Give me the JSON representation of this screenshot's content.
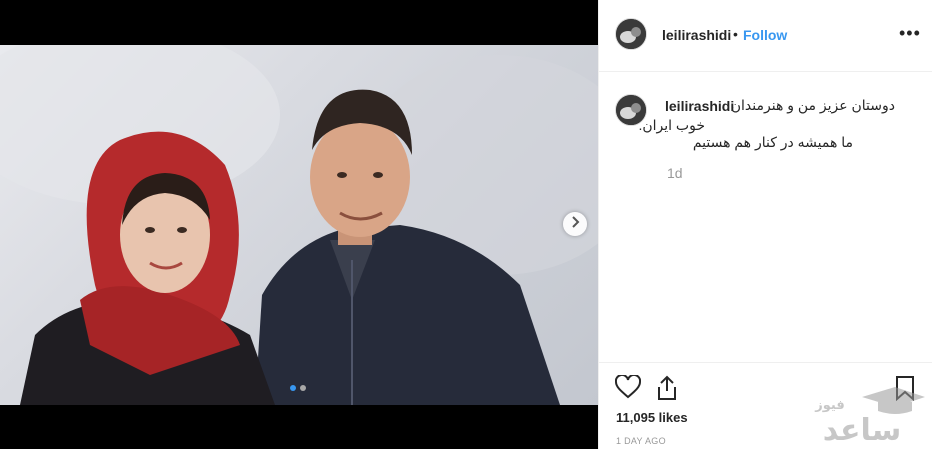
{
  "post": {
    "username": "leilirashidi",
    "bullet": "•",
    "follow_label": "Follow",
    "more_label": "•••",
    "caption_lines": [
      "دوستان عزیز من و هنرمندان",
      "خوب ایران.",
      "ما همیشه در کنار هم هستیم"
    ],
    "timestamp": "1d",
    "likes": "11,095 likes",
    "date": "1 DAY AGO"
  },
  "carousel": {
    "count": 2,
    "active_index": 0
  },
  "watermark": {
    "text_top": "فیوز",
    "text_bottom": "ساعد"
  },
  "colors": {
    "link": "#3897f0",
    "muted": "#999999",
    "text": "#262626",
    "border": "#efefef"
  },
  "icons": [
    "chevron-right-icon",
    "heart-icon",
    "share-icon",
    "bookmark-icon",
    "graduation-cap-icon"
  ]
}
